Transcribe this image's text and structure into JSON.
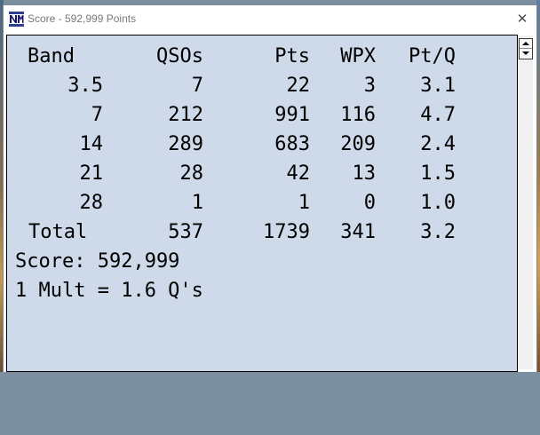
{
  "window": {
    "title": "Score - 592,999 Points",
    "close_glyph": "✕"
  },
  "table": {
    "headers": {
      "band": "Band",
      "qsos": "QSOs",
      "pts": "Pts",
      "wpx": "WPX",
      "ptq": "Pt/Q"
    },
    "rows": [
      {
        "band": "3.5",
        "qsos": "7",
        "pts": "22",
        "wpx": "3",
        "ptq": "3.1"
      },
      {
        "band": "7",
        "qsos": "212",
        "pts": "991",
        "wpx": "116",
        "ptq": "4.7"
      },
      {
        "band": "14",
        "qsos": "289",
        "pts": "683",
        "wpx": "209",
        "ptq": "2.4"
      },
      {
        "band": "21",
        "qsos": "28",
        "pts": "42",
        "wpx": "13",
        "ptq": "1.5"
      },
      {
        "band": "28",
        "qsos": "1",
        "pts": "1",
        "wpx": "0",
        "ptq": "1.0"
      }
    ],
    "total": {
      "band": "Total",
      "qsos": "537",
      "pts": "1739",
      "wpx": "341",
      "ptq": "3.2"
    }
  },
  "summary": {
    "score_line": "Score: 592,999",
    "mult_line": "1 Mult = 1.6 Q's"
  },
  "icons": {
    "app": "n1mm-logo-icon",
    "close": "close-icon",
    "scroll_up": "scroll-up-arrow-icon",
    "scroll_down": "scroll-down-arrow-icon"
  },
  "colors": {
    "client_background": "#ced9e9",
    "title_text": "#7a7a7a"
  }
}
